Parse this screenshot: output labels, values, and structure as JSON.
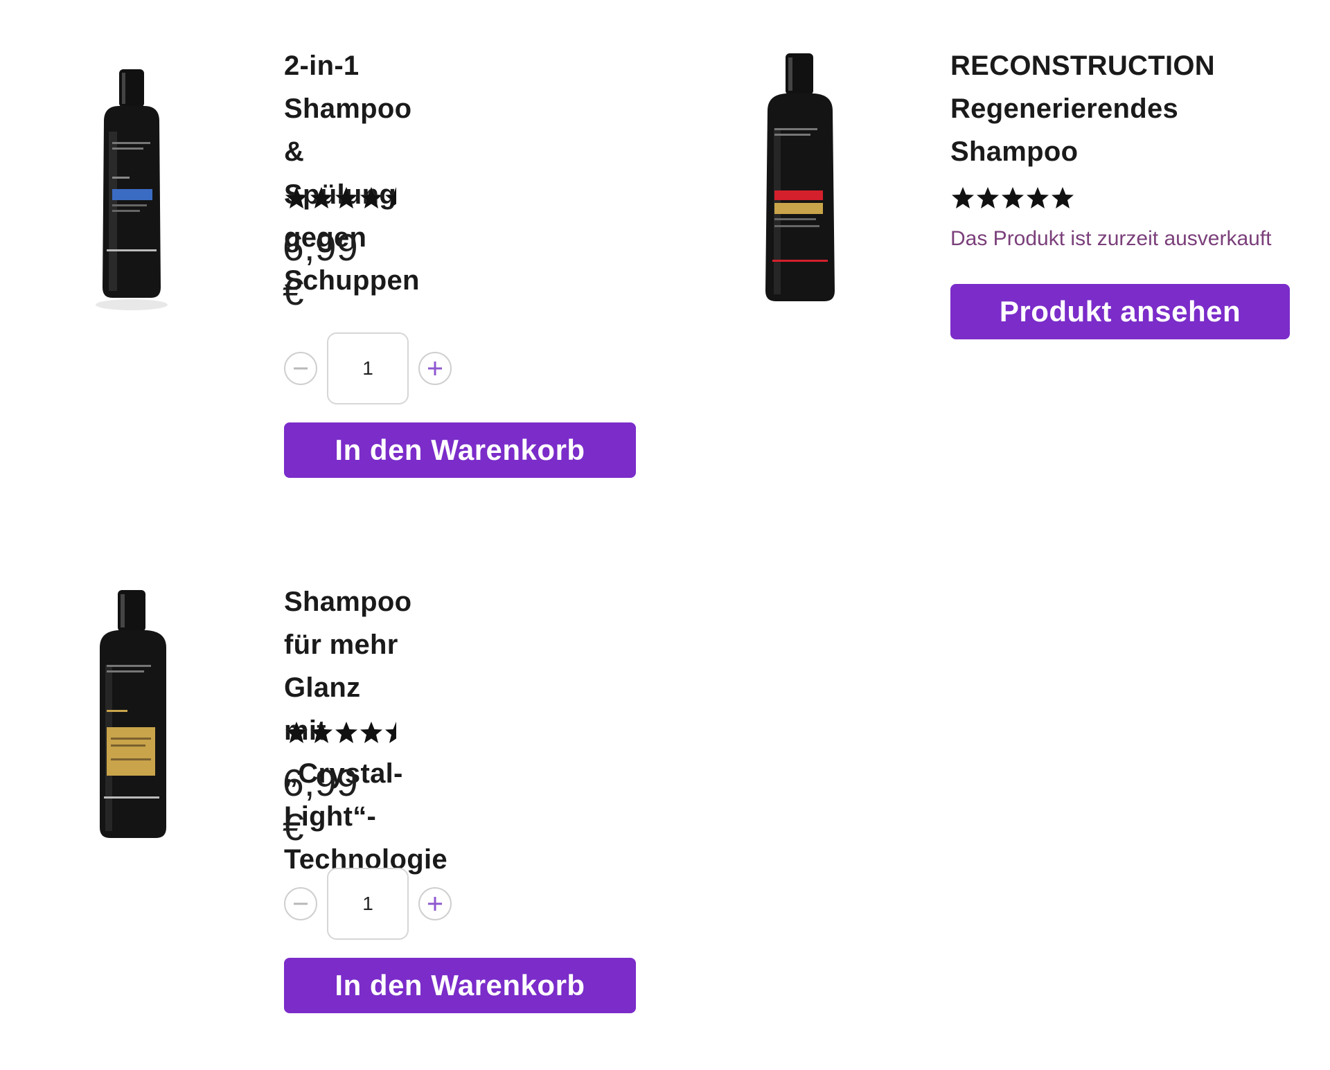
{
  "products": [
    {
      "title_lines": [
        "2-in-1 Shampoo &",
        "Spülung gegen",
        "Schuppen"
      ],
      "rating": 4.5,
      "price": "6,99 €",
      "quantity": "1",
      "button_label": "In den Warenkorb",
      "label_color": "#3b6cc4"
    },
    {
      "title_lines": [
        "RECONSTRUCTION",
        "Regenerierendes",
        "Shampoo"
      ],
      "rating": 5,
      "stock_text": "Das Produkt ist zurzeit ausverkauft",
      "button_label": "Produkt ansehen",
      "label_color": "#d4202c"
    },
    {
      "title_lines": [
        "Shampoo für mehr Glanz",
        "mit „Crystal-Light“-",
        "Technologie"
      ],
      "rating": 4.5,
      "price": "6,99 €",
      "quantity": "1",
      "button_label": "In den Warenkorb",
      "label_color": "#c9a44a"
    }
  ],
  "icons": {
    "minus": "minus-circle-icon",
    "plus": "plus-circle-icon",
    "star": "star-icon"
  },
  "colors": {
    "accent": "#7b2cc9",
    "out_of_stock_text": "#7a3f7a"
  }
}
